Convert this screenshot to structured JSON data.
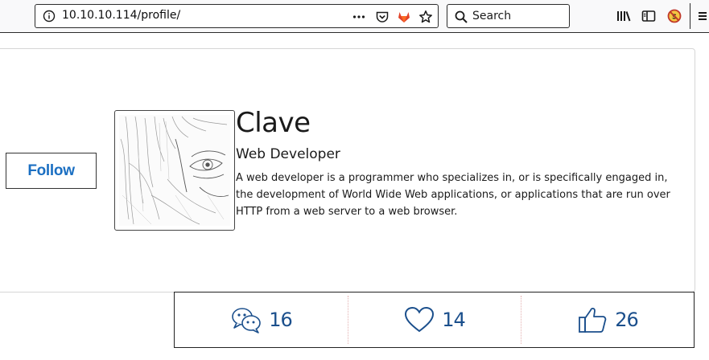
{
  "browser": {
    "url": "10.10.10.114/profile/",
    "search_placeholder": "Search",
    "icons": [
      "info-icon",
      "more-icon",
      "pocket-icon",
      "gitlab-icon",
      "bookmark-star-icon",
      "search-icon",
      "library-icon",
      "sidebar-icon",
      "noscript-icon",
      "menu-icon"
    ]
  },
  "profile": {
    "follow_label": "Follow",
    "name": "Clave",
    "role": "Web Developer",
    "bio": "A web developer is a programmer who specializes in, or is specifically engaged in, the development of World Wide Web applications, or applications that are run over HTTP from a web server to a web browser."
  },
  "stats": {
    "comments": "16",
    "likes": "14",
    "thumbs_up": "26"
  },
  "colors": {
    "accent": "#1b6fc2",
    "stat_text": "#1b4f8c"
  }
}
